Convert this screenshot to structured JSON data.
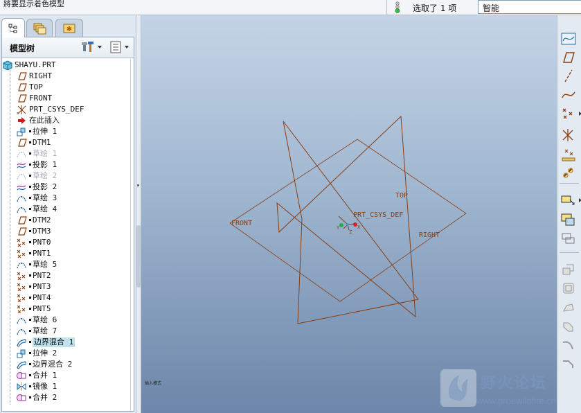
{
  "status_bar": {
    "message": "將要显示着色模型",
    "selection_count": "选取了 1 项",
    "filter_value": "智能"
  },
  "panel_tabs": [
    {
      "name": "model-tree",
      "icon": "tree-icon"
    },
    {
      "name": "layers",
      "icon": "folders-icon"
    },
    {
      "name": "favorites",
      "icon": "star-folder-icon"
    }
  ],
  "model_tree": {
    "title": "模型树",
    "root": "SHAYU.PRT",
    "items": [
      {
        "label": "RIGHT",
        "icon": "datum-plane-icon",
        "bullet": false,
        "state": "normal"
      },
      {
        "label": "TOP",
        "icon": "datum-plane-icon",
        "bullet": false,
        "state": "normal"
      },
      {
        "label": "FRONT",
        "icon": "datum-plane-icon",
        "bullet": false,
        "state": "normal"
      },
      {
        "label": "PRT_CSYS_DEF",
        "icon": "csys-icon",
        "bullet": false,
        "state": "normal"
      },
      {
        "label": "在此插入",
        "icon": "insert-arrow-icon",
        "bullet": false,
        "state": "normal"
      },
      {
        "label": "拉伸 1",
        "icon": "extrude-icon",
        "bullet": true,
        "state": "normal"
      },
      {
        "label": "DTM1",
        "icon": "datum-plane-icon",
        "bullet": true,
        "state": "normal"
      },
      {
        "label": "草绘 1",
        "icon": "sketch-icon",
        "bullet": true,
        "state": "dim"
      },
      {
        "label": "投影 1",
        "icon": "projection-icon",
        "bullet": true,
        "state": "normal"
      },
      {
        "label": "草绘 2",
        "icon": "sketch-icon",
        "bullet": true,
        "state": "dim"
      },
      {
        "label": "投影 2",
        "icon": "projection-icon",
        "bullet": true,
        "state": "normal"
      },
      {
        "label": "草绘 3",
        "icon": "sketch-icon",
        "bullet": true,
        "state": "normal"
      },
      {
        "label": "草绘 4",
        "icon": "sketch-icon",
        "bullet": true,
        "state": "normal"
      },
      {
        "label": "DTM2",
        "icon": "datum-plane-icon",
        "bullet": true,
        "state": "normal"
      },
      {
        "label": "DTM3",
        "icon": "datum-plane-icon",
        "bullet": true,
        "state": "normal"
      },
      {
        "label": "PNT0",
        "icon": "datum-point-icon",
        "bullet": true,
        "state": "normal"
      },
      {
        "label": "PNT1",
        "icon": "datum-point-icon",
        "bullet": true,
        "state": "normal"
      },
      {
        "label": "草绘 5",
        "icon": "sketch-icon",
        "bullet": true,
        "state": "normal"
      },
      {
        "label": "PNT2",
        "icon": "datum-point-icon",
        "bullet": true,
        "state": "normal"
      },
      {
        "label": "PNT3",
        "icon": "datum-point-icon",
        "bullet": true,
        "state": "normal"
      },
      {
        "label": "PNT4",
        "icon": "datum-point-icon",
        "bullet": true,
        "state": "normal"
      },
      {
        "label": "PNT5",
        "icon": "datum-point-icon",
        "bullet": true,
        "state": "normal"
      },
      {
        "label": "草绘 6",
        "icon": "sketch-icon",
        "bullet": true,
        "state": "normal"
      },
      {
        "label": "草绘 7",
        "icon": "sketch-icon",
        "bullet": true,
        "state": "normal"
      },
      {
        "label": "边界混合 1",
        "icon": "boundary-blend-icon",
        "bullet": true,
        "state": "selected"
      },
      {
        "label": "拉伸 2",
        "icon": "extrude-icon",
        "bullet": true,
        "state": "normal"
      },
      {
        "label": "边界混合 2",
        "icon": "boundary-blend-icon",
        "bullet": true,
        "state": "normal"
      },
      {
        "label": "合并 1",
        "icon": "merge-icon",
        "bullet": true,
        "state": "normal"
      },
      {
        "label": "镜像 1",
        "icon": "mirror-icon",
        "bullet": true,
        "state": "normal"
      },
      {
        "label": "合并 2",
        "icon": "merge-icon",
        "bullet": true,
        "state": "normal"
      }
    ]
  },
  "viewport": {
    "labels": {
      "front": "FRONT",
      "top": "TOP",
      "right": "RIGHT",
      "csys": "PRT_CSYS_DEF",
      "x_axis": "X",
      "y_axis": "Y",
      "z_axis": "Z"
    },
    "status_tiny": "插入模式",
    "watermark": {
      "name": "野火论坛",
      "url": "www.proewildfire.cn"
    }
  },
  "right_toolbar": [
    {
      "name": "sketch-tool",
      "icon": "sketch-curve-icon"
    },
    {
      "name": "datum-plane-tool",
      "icon": "datum-plane-icon"
    },
    {
      "name": "datum-axis-tool",
      "icon": "datum-axis-icon"
    },
    {
      "name": "datum-curve-tool",
      "icon": "datum-curve-icon"
    },
    {
      "name": "datum-point-tool",
      "icon": "datum-point-icon"
    },
    {
      "name": "csys-tool",
      "icon": "csys-icon"
    },
    {
      "name": "analysis-feature-tool",
      "icon": "analysis-icon"
    },
    {
      "name": "datum-link-tool",
      "icon": "chain-icon"
    },
    {
      "name": "insert-feature-tool",
      "icon": "insert-feature-icon"
    },
    {
      "name": "copy-feature-tool",
      "icon": "copy-feature-icon"
    },
    {
      "name": "group-tool",
      "icon": "group-icon"
    },
    {
      "name": "extrude-tool",
      "icon": "extrude-icon"
    },
    {
      "name": "revolve-tool",
      "icon": "revolve-icon"
    },
    {
      "name": "sweep-tool",
      "icon": "sweep-icon"
    },
    {
      "name": "blend-tool",
      "icon": "blend-icon"
    },
    {
      "name": "round-tool",
      "icon": "round-icon"
    },
    {
      "name": "chamfer-tool",
      "icon": "chamfer-icon"
    }
  ],
  "colors": {
    "datum": "#8a3d10",
    "selected": "#bfe3ec",
    "accent": "#2b6cb0"
  }
}
